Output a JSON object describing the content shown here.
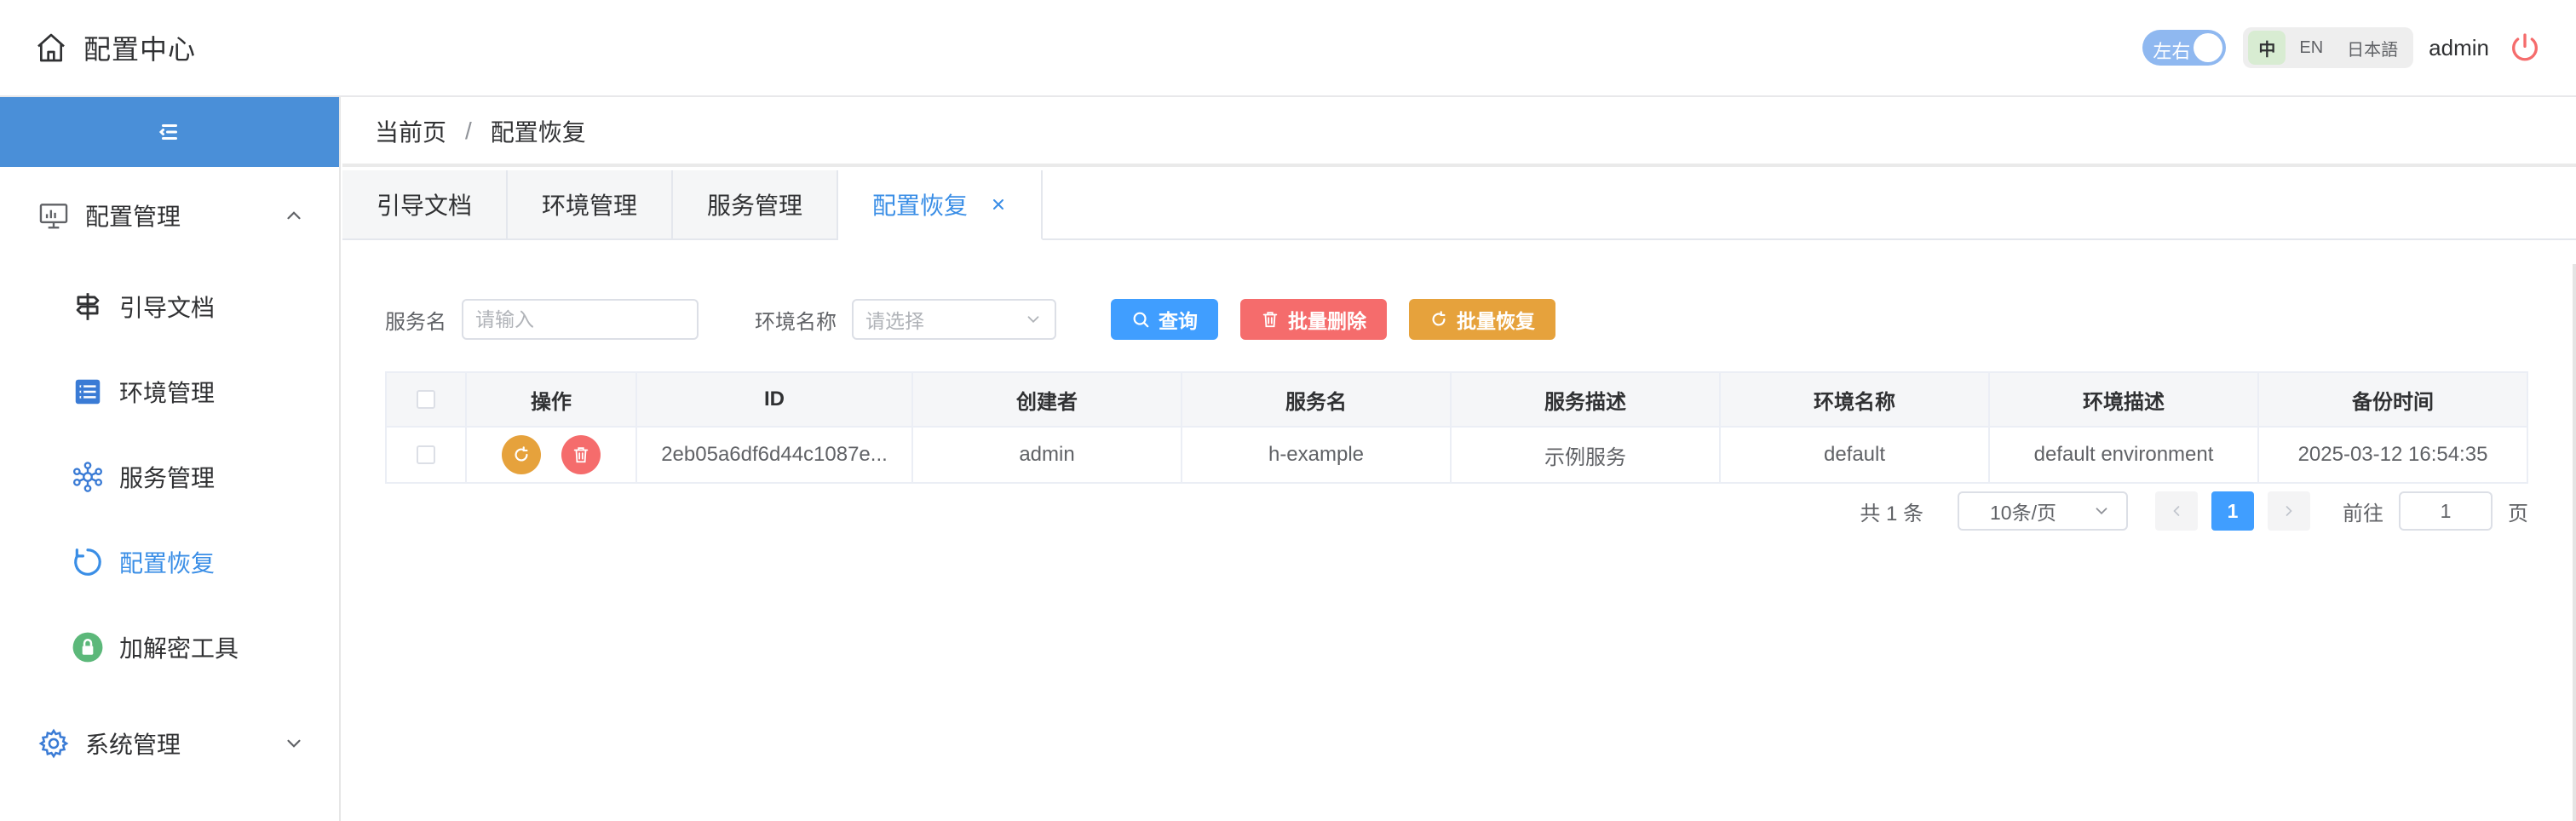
{
  "header": {
    "title": "配置中心",
    "layout_toggle_label": "左右",
    "languages": [
      "中",
      "EN",
      "日本語"
    ],
    "active_language": "中",
    "username": "admin"
  },
  "sidebar": {
    "groups": [
      {
        "label": "配置管理",
        "expanded": true,
        "items": [
          {
            "label": "引导文档",
            "icon": "signpost-icon"
          },
          {
            "label": "环境管理",
            "icon": "server-list-icon"
          },
          {
            "label": "服务管理",
            "icon": "network-nodes-icon"
          },
          {
            "label": "配置恢复",
            "icon": "restore-icon",
            "active": true
          },
          {
            "label": "加解密工具",
            "icon": "lock-icon"
          }
        ]
      },
      {
        "label": "系统管理",
        "expanded": false,
        "items": []
      }
    ]
  },
  "breadcrumb": [
    "当前页",
    "配置恢复"
  ],
  "breadcrumb_sep": "/",
  "tabs": [
    {
      "label": "引导文档"
    },
    {
      "label": "环境管理"
    },
    {
      "label": "服务管理"
    },
    {
      "label": "配置恢复",
      "active": true,
      "closable": true
    }
  ],
  "filters": {
    "service_label": "服务名",
    "service_placeholder": "请输入",
    "env_label": "环境名称",
    "env_placeholder": "请选择",
    "query_btn": "查询",
    "batch_delete_btn": "批量删除",
    "batch_restore_btn": "批量恢复"
  },
  "table": {
    "columns": [
      "操作",
      "ID",
      "创建者",
      "服务名",
      "服务描述",
      "环境名称",
      "环境描述",
      "备份时间"
    ],
    "rows": [
      {
        "id": "2eb05a6df6d44c1087e...",
        "creator": "admin",
        "service": "h-example",
        "service_desc": "示例服务",
        "env": "default",
        "env_desc": "default environment",
        "backup_time": "2025-03-12 16:54:35"
      }
    ]
  },
  "pagination": {
    "total_text": "共 1 条",
    "page_size": "10条/页",
    "current_page": "1",
    "goto_label": "前往",
    "goto_value": "1",
    "goto_unit": "页"
  },
  "colors": {
    "primary": "#409eff",
    "danger": "#f56c6c",
    "warning": "#e6a23c",
    "sidebar_bar": "#4a8fd8",
    "success": "#5cb87a"
  }
}
